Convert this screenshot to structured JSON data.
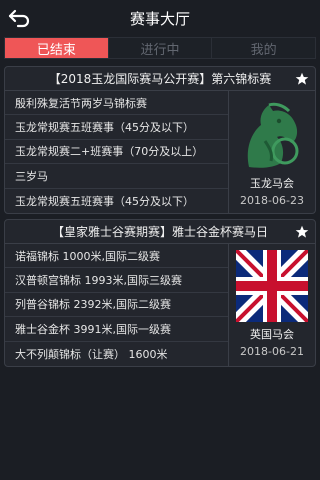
{
  "header": {
    "title": "赛事大厅"
  },
  "tabs": [
    {
      "label": "已结束",
      "active": true
    },
    {
      "label": "进行中",
      "active": false
    },
    {
      "label": "我的",
      "active": false
    }
  ],
  "cards": [
    {
      "title": "【2018玉龙国际赛马公开赛】第六锦标赛",
      "races": [
        "殷利殊复活节两岁马锦标赛",
        "玉龙常规赛五班赛事（45分及以下）",
        "玉龙常规赛二+班赛事（70分及以上）",
        "三岁马",
        "玉龙常规赛五班赛事（45分及以下）"
      ],
      "club": {
        "name": "玉龙马会",
        "date": "2018-06-23",
        "logo": "green-horse-logo"
      }
    },
    {
      "title": "【皇家雅士谷赛期赛】雅士谷金杯赛马日",
      "races": [
        "诺福锦标 1000米,国际二级赛",
        "汉普顿宫锦标 1993米,国际三级赛",
        "列普谷锦标 2392米,国际二级赛",
        "雅士谷金杯 3991米,国际一级赛",
        "大不列颠锦标（让赛） 1600米"
      ],
      "club": {
        "name": "英国马会",
        "date": "2018-06-21",
        "logo": "union-jack-flag"
      }
    }
  ],
  "colors": {
    "accent": "#ef5657",
    "background": "#1b1e24",
    "card": "#23262d"
  },
  "icons": [
    "back-arrow-icon",
    "star-icon"
  ]
}
